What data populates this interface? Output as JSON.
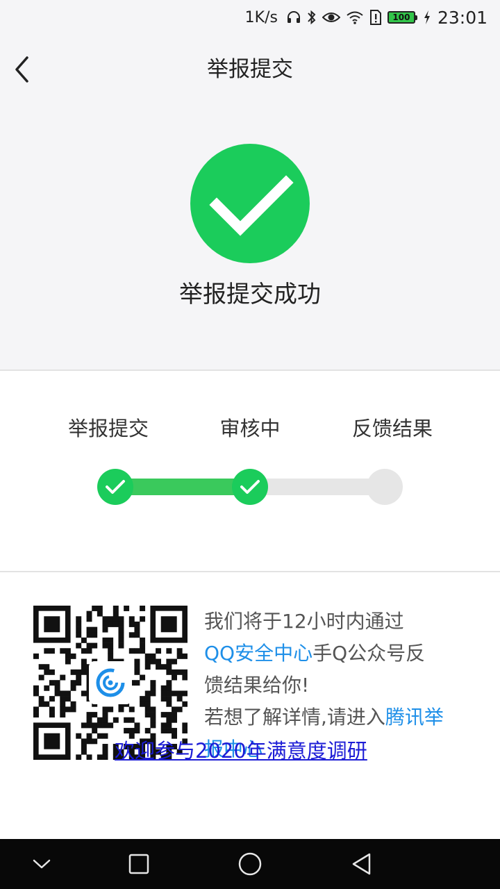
{
  "status_bar": {
    "net_speed": "1K/s",
    "battery_level": "100",
    "time": "23:01",
    "icons": [
      "headset-icon",
      "bluetooth-icon",
      "eye-icon",
      "wifi-icon",
      "sim-alert-icon",
      "battery-icon",
      "charging-icon"
    ]
  },
  "nav": {
    "title": "举报提交",
    "back_icon": "chevron-left-icon"
  },
  "result": {
    "icon": "check-circle-icon",
    "message": "举报提交成功",
    "accent_color": "#1bcc5b"
  },
  "progress": {
    "steps": [
      {
        "label": "举报提交",
        "status": "done"
      },
      {
        "label": "审核中",
        "status": "done"
      },
      {
        "label": "反馈结果",
        "status": "pending"
      }
    ],
    "done_color": "#3ac95c",
    "pending_color": "#e6e6e6"
  },
  "info": {
    "qr_icon": "qr-code-icon",
    "line1": "我们将于12小时内通过",
    "link_security_center": "QQ安全中心",
    "line2_rest": "手Q公众号反",
    "line3": "馈结果给你!",
    "line4_prefix": "若想了解详情,请进入",
    "link_tencent": "腾讯举报中心",
    "survey_link": "欢迎参与2020年满意度调研",
    "link_color": "#1e8fe8"
  },
  "system_nav": {
    "icons": [
      "chevron-down-icon",
      "square-icon",
      "circle-icon",
      "triangle-back-icon"
    ]
  }
}
